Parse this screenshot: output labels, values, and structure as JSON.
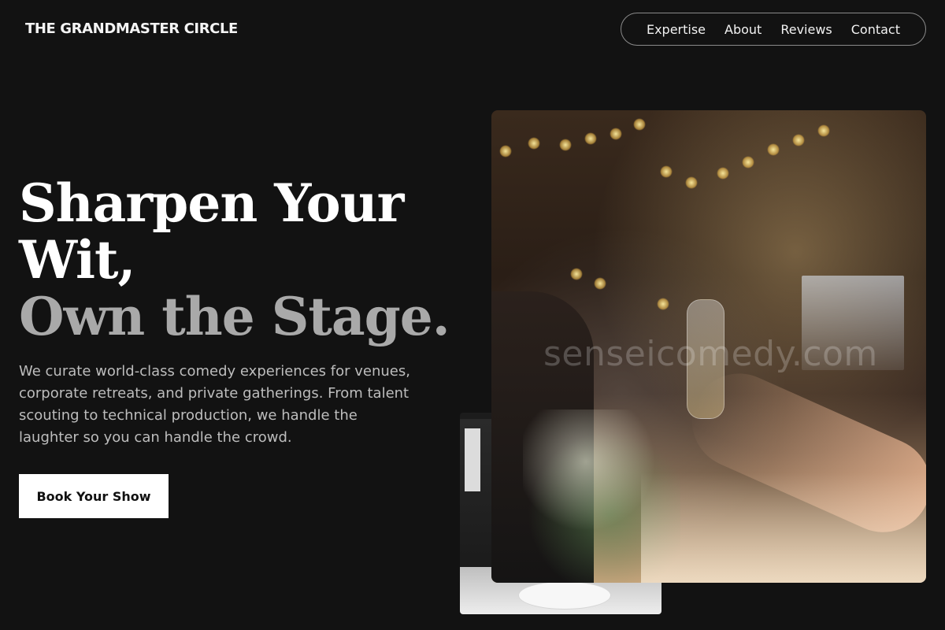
{
  "header": {
    "brand": "THE GRANDMASTER CIRCLE",
    "nav": [
      {
        "label": "Expertise"
      },
      {
        "label": "About"
      },
      {
        "label": "Reviews"
      },
      {
        "label": "Contact"
      }
    ]
  },
  "hero": {
    "headline_line1": "Sharpen Your",
    "headline_line2": "Wit,",
    "headline_line3": "Own the Stage.",
    "subtext": "We curate world-class comedy experiences for venues, corporate retreats, and private gatherings. From talent scouting to technical production, we handle the laughter so you can handle the crowd.",
    "cta_label": "Book Your Show"
  },
  "images": {
    "watermark": "senseicomedy.com"
  },
  "colors": {
    "background": "#121212",
    "text": "#ffffff",
    "muted": "#bdbdbd",
    "headline_muted": "#a9a9a9",
    "button_bg": "#ffffff",
    "button_text": "#111111"
  }
}
